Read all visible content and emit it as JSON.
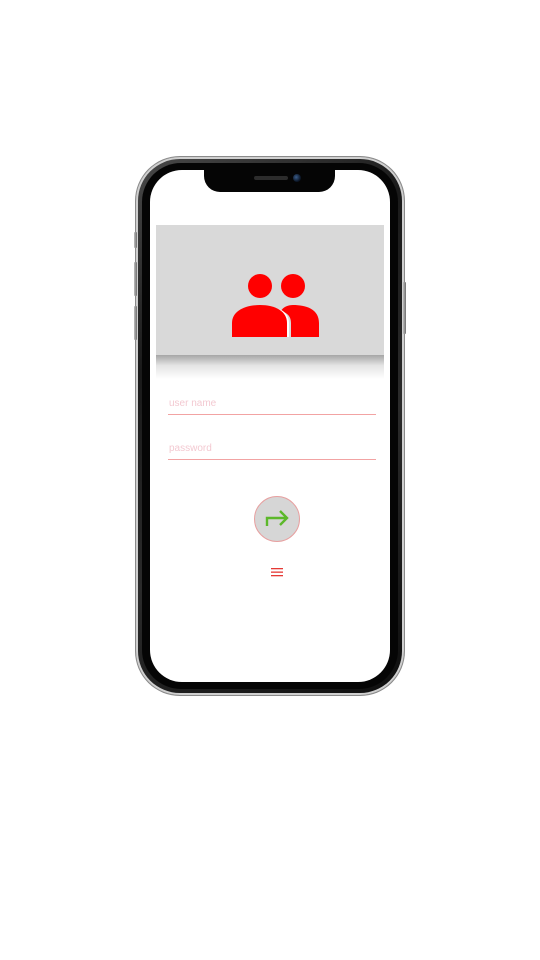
{
  "form": {
    "username_placeholder": "user name",
    "username_value": "",
    "password_placeholder": "password",
    "password_value": ""
  },
  "icons": {
    "header": "users-icon",
    "submit": "arrow-right-icon",
    "menu": "hamburger-menu-icon"
  },
  "colors": {
    "accent": "#ff0000",
    "header_bg": "#d9d9d9",
    "submit_arrow": "#5cb82a",
    "field_underline": "#f2a3a3"
  }
}
